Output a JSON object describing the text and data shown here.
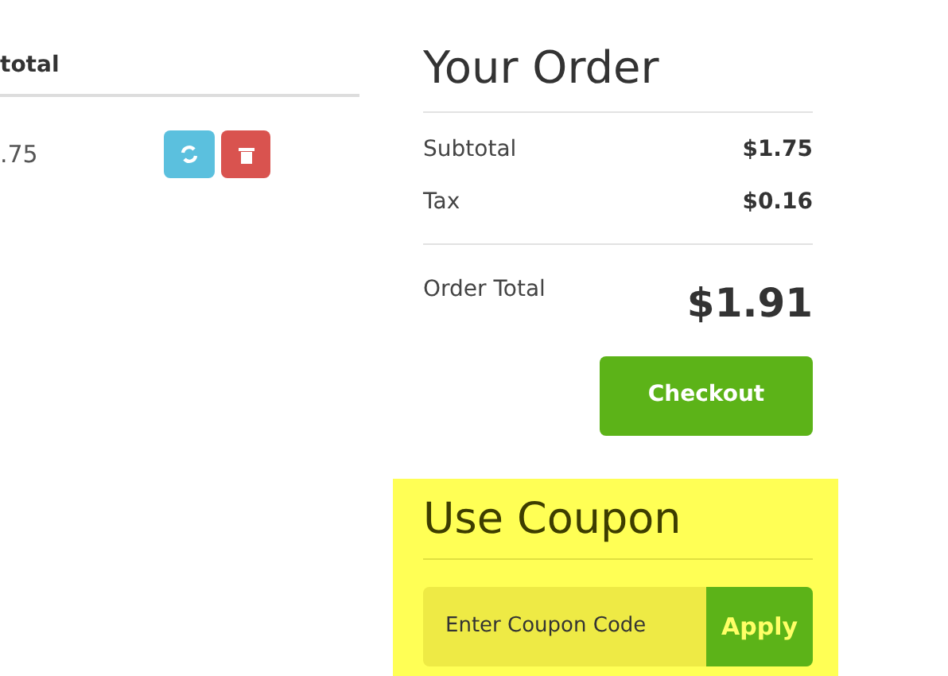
{
  "cart": {
    "column_heading": "total",
    "row": {
      "subtotal": ".75"
    }
  },
  "order": {
    "title": "Your Order",
    "lines": [
      {
        "label": "Subtotal",
        "value": "$1.75"
      },
      {
        "label": "Tax",
        "value": "$0.16"
      }
    ],
    "total_label": "Order Total",
    "total_value": "$1.91",
    "checkout": "Checkout"
  },
  "coupon": {
    "title": "Use Coupon",
    "placeholder": "Enter Coupon Code",
    "apply": "Apply"
  }
}
